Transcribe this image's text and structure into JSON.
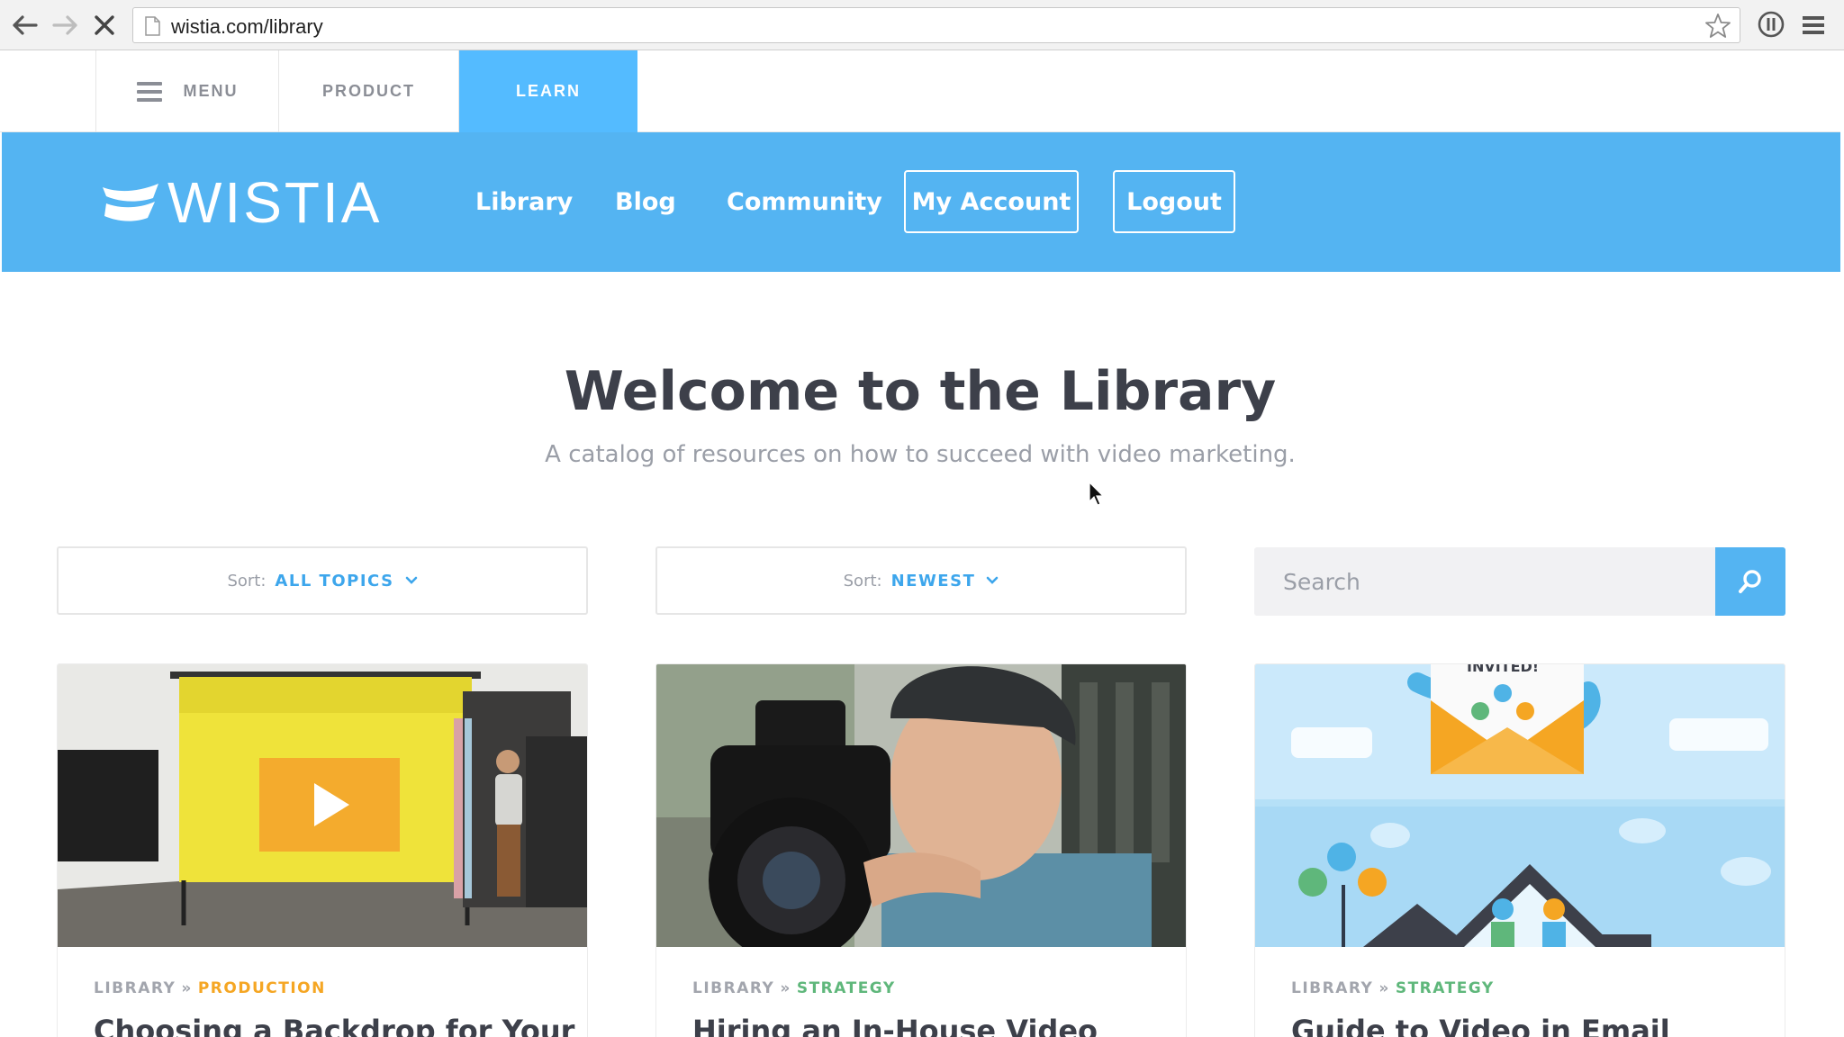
{
  "browser": {
    "url": "wistia.com/library",
    "colors": {
      "chrome_bg": "#f2f2f2"
    }
  },
  "topbar": {
    "menu_label": "MENU",
    "product_label": "PRODUCT",
    "learn_label": "LEARN"
  },
  "header": {
    "logo_text": "WISTIA",
    "nav": [
      "Library",
      "Blog",
      "Community"
    ],
    "account_button": "My Account",
    "logout_button": "Logout",
    "colors": {
      "brand_blue": "#54b4f2"
    }
  },
  "hero": {
    "title": "Welcome to the Library",
    "subtitle": "A catalog of resources on how to succeed with video marketing."
  },
  "filters": {
    "topic_sort": {
      "label": "Sort:",
      "value": "ALL TOPICS"
    },
    "order_sort": {
      "label": "Sort:",
      "value": "NEWEST"
    },
    "search": {
      "placeholder": "Search"
    }
  },
  "cards": [
    {
      "root": "LIBRARY",
      "separator": "»",
      "category": "PRODUCTION",
      "category_color": "#f5a623",
      "title": "Choosing a Backdrop for Your"
    },
    {
      "root": "LIBRARY",
      "separator": "»",
      "category": "STRATEGY",
      "category_color": "#5fb77b",
      "title": "Hiring an In-House Video"
    },
    {
      "root": "LIBRARY",
      "separator": "»",
      "category": "STRATEGY",
      "category_color": "#5fb77b",
      "title": "Guide to Video in Email"
    }
  ],
  "card3_art_text": "INVITED!"
}
